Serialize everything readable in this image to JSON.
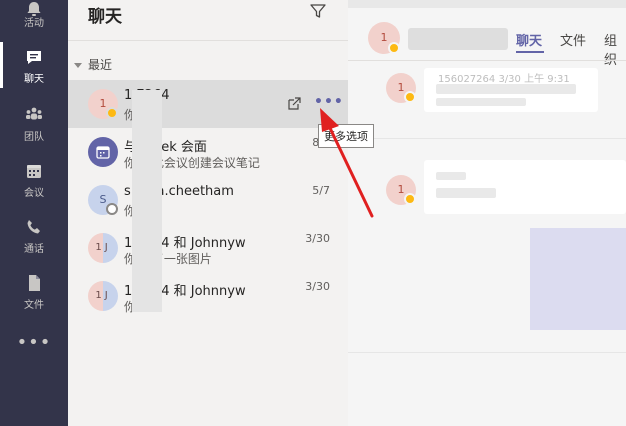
{
  "rail": {
    "items": [
      {
        "label": "活动",
        "icon": "bell-icon"
      },
      {
        "label": "聊天",
        "icon": "chat-icon",
        "active": true
      },
      {
        "label": "团队",
        "icon": "teams-icon"
      },
      {
        "label": "会议",
        "icon": "calendar-icon"
      },
      {
        "label": "通话",
        "icon": "phone-icon"
      },
      {
        "label": "文件",
        "icon": "file-icon"
      }
    ],
    "more": "•••"
  },
  "list": {
    "title": "聊天",
    "section": "最近",
    "chats": [
      {
        "avatar": "1",
        "name": "1   7264",
        "preview": "你",
        "date": "",
        "selected": true,
        "status": "away"
      },
      {
        "avatar": "",
        "name": "与   nstek 会面",
        "preview": "你   为此会议创建会议笔记",
        "date": "8/9",
        "status": "none"
      },
      {
        "avatar": "S",
        "name": "s   ntha.cheetham",
        "preview": "你",
        "date": "5/7",
        "status": "offline"
      },
      {
        "avatar": "1J",
        "name": "1   7264 和 Johnnyw",
        "preview": "你   送了一张图片",
        "date": "3/30",
        "status": "none"
      },
      {
        "avatar": "1J",
        "name": "1   7264 和 Johnnyw",
        "preview": "你",
        "date": "3/30",
        "status": "none"
      }
    ],
    "more_options_tooltip": "更多选项",
    "more_dots": "•••"
  },
  "main": {
    "header_avatar": "1",
    "tabs": [
      "聊天",
      "文件",
      "组织"
    ],
    "active_tab": "聊天",
    "messages": [
      {
        "avatar": "1",
        "preview": "156027264  3/30 上午 9:31"
      },
      {
        "avatar": "1",
        "preview": ""
      }
    ]
  },
  "colors": {
    "rail_bg": "#33344a",
    "accent": "#6264a7",
    "away": "#fdb913",
    "annotation_arrow": "#e02020"
  }
}
